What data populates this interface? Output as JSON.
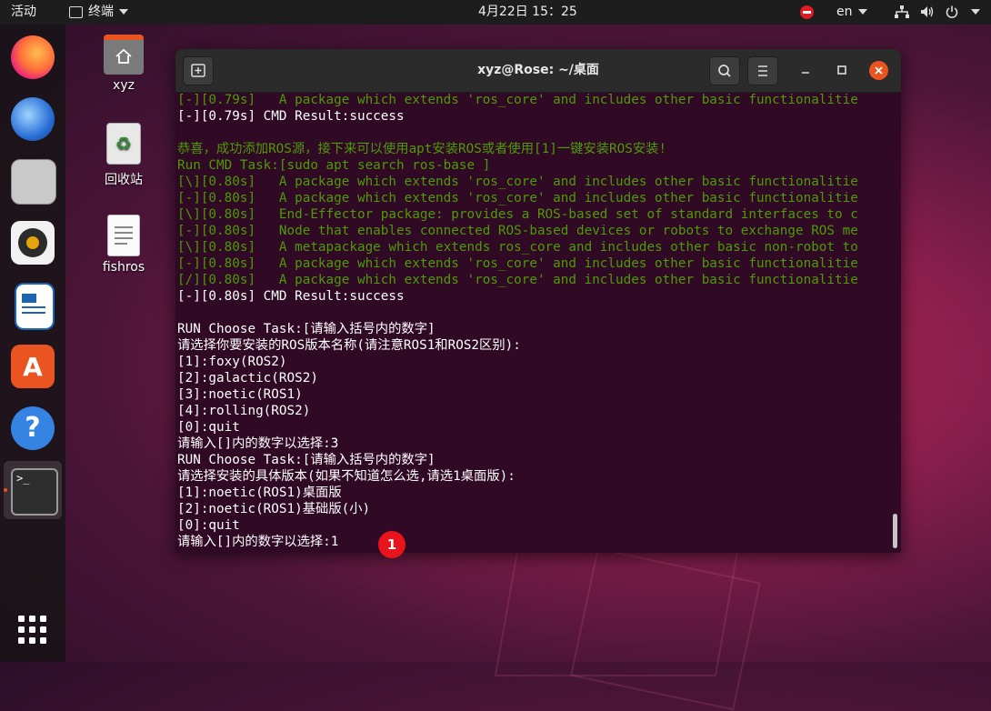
{
  "topbar": {
    "activities": "活动",
    "app_menu": "终端",
    "clock": "4月22日 15：25",
    "lang": "en"
  },
  "desktop": {
    "icons": [
      {
        "label": "xyz"
      },
      {
        "label": "回收站"
      },
      {
        "label": "fishros"
      }
    ]
  },
  "terminal": {
    "title": "xyz@Rose: ~/桌面",
    "lines": [
      {
        "text": "[-][0.79s]   A package which extends 'ros_core' and includes other basic functionalitie",
        "color": "g"
      },
      {
        "text": "[-][0.79s] CMD Result:success",
        "color": "w"
      },
      {
        "text": "",
        "color": "w"
      },
      {
        "text": "恭喜，成功添加ROS源，接下来可以使用apt安装ROS或者使用[1]一键安装ROS安装!",
        "color": "g"
      },
      {
        "text": "Run CMD Task:[sudo apt search ros-base ]",
        "color": "g"
      },
      {
        "text": "[\\][0.80s]   A package which extends 'ros_core' and includes other basic functionalitie",
        "color": "g"
      },
      {
        "text": "[-][0.80s]   A package which extends 'ros_core' and includes other basic functionalitie",
        "color": "g"
      },
      {
        "text": "[\\][0.80s]   End-Effector package: provides a ROS-based set of standard interfaces to c",
        "color": "g"
      },
      {
        "text": "[-][0.80s]   Node that enables connected ROS-based devices or robots to exchange ROS me",
        "color": "g"
      },
      {
        "text": "[\\][0.80s]   A metapackage which extends ros_core and includes other basic non-robot to",
        "color": "g"
      },
      {
        "text": "[-][0.80s]   A package which extends 'ros_core' and includes other basic functionalitie",
        "color": "g"
      },
      {
        "text": "[/][0.80s]   A package which extends 'ros_core' and includes other basic functionalitie",
        "color": "g"
      },
      {
        "text": "[-][0.80s] CMD Result:success",
        "color": "w"
      },
      {
        "text": "",
        "color": "w"
      },
      {
        "text": "RUN Choose Task:[请输入括号内的数字]",
        "color": "w"
      },
      {
        "text": "请选择你要安装的ROS版本名称(请注意ROS1和ROS2区别):",
        "color": "w"
      },
      {
        "text": "[1]:foxy(ROS2)",
        "color": "w"
      },
      {
        "text": "[2]:galactic(ROS2)",
        "color": "w"
      },
      {
        "text": "[3]:noetic(ROS1)",
        "color": "w"
      },
      {
        "text": "[4]:rolling(ROS2)",
        "color": "w"
      },
      {
        "text": "[0]:quit",
        "color": "w"
      },
      {
        "text": "请输入[]内的数字以选择:3",
        "color": "w"
      },
      {
        "text": "RUN Choose Task:[请输入括号内的数字]",
        "color": "w"
      },
      {
        "text": "请选择安装的具体版本(如果不知道怎么选,请选1桌面版):",
        "color": "w"
      },
      {
        "text": "[1]:noetic(ROS1)桌面版",
        "color": "w"
      },
      {
        "text": "[2]:noetic(ROS1)基础版(小)",
        "color": "w"
      },
      {
        "text": "[0]:quit",
        "color": "w"
      },
      {
        "text": "请输入[]内的数字以选择:1",
        "color": "w"
      }
    ]
  },
  "annotation": {
    "badge": "1"
  }
}
